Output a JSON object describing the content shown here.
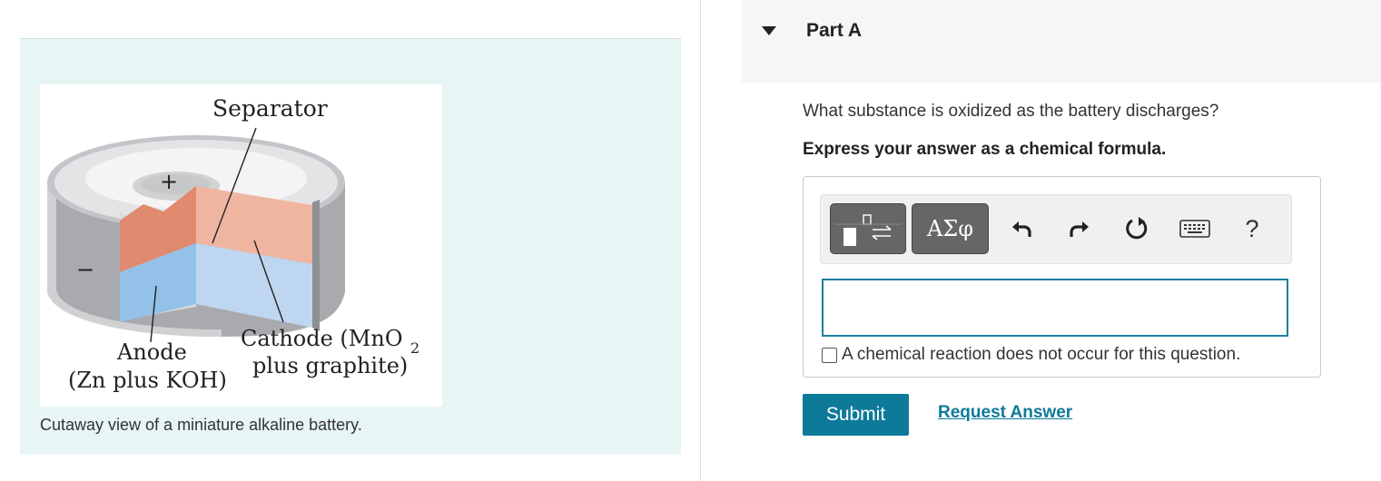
{
  "figure": {
    "caption": "Cutaway view of a miniature alkaline battery.",
    "labels": {
      "separator": "Separator",
      "plus": "+",
      "minus": "−",
      "anode": "Anode",
      "anode_sub": "(Zn plus KOH)",
      "cathode": "Cathode (MnO",
      "cathode_sub_digit": "2",
      "cathode_sub": "plus graphite)"
    }
  },
  "part": {
    "title": "Part A"
  },
  "question": {
    "text": "What substance is oxidized as the battery discharges?",
    "instruction": "Express your answer as a chemical formula."
  },
  "toolbar": {
    "greek_label": "ΑΣφ",
    "help_label": "?",
    "icons": [
      "templates-icon",
      "greek-letters-icon",
      "undo-icon",
      "redo-icon",
      "reset-icon",
      "keyboard-icon",
      "help-icon"
    ]
  },
  "answer": {
    "value": "",
    "checkbox_label": "A chemical reaction does not occur for this question.",
    "checkbox_checked": false
  },
  "actions": {
    "submit_label": "Submit",
    "request_label": "Request Answer"
  },
  "colors": {
    "accent": "#0d7a9a",
    "panel_bg": "#e8f5f5",
    "cathode": "#efb5a0",
    "anode": "#b8d3ee"
  }
}
